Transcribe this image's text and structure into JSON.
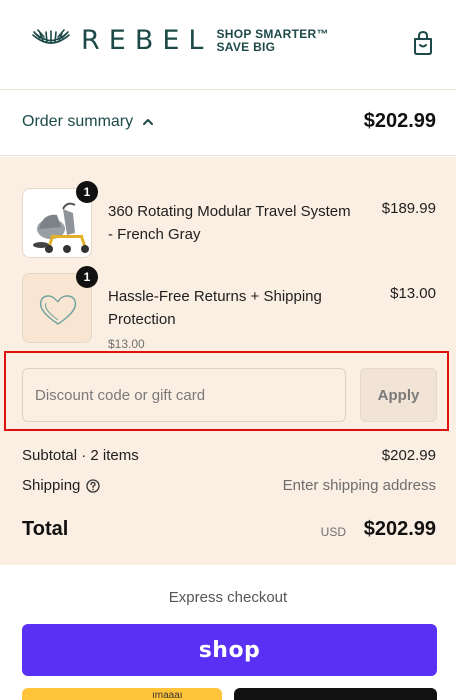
{
  "brand": {
    "name": "REBEL",
    "tagline_line1": "SHOP SMARTER™",
    "tagline_line2": "SAVE BIG",
    "color": "#1d4a48"
  },
  "summary": {
    "toggle_label": "Order summary",
    "total": "$202.99"
  },
  "items": [
    {
      "name": "360 Rotating Modular Travel System - French Gray",
      "price": "$189.99",
      "quantity": "1",
      "image": "stroller-image"
    },
    {
      "name": "Hassle-Free Returns + Shipping Protection",
      "price": "$13.00",
      "unit_price": "$13.00",
      "quantity": "1",
      "image": "heart-icon"
    }
  ],
  "discount": {
    "placeholder": "Discount code or gift card",
    "apply_label": "Apply"
  },
  "totals": {
    "subtotal_label": "Subtotal · 2 items",
    "subtotal_value": "$202.99",
    "shipping_label": "Shipping",
    "shipping_value": "Enter shipping address",
    "total_label": "Total",
    "currency": "USD",
    "total_value": "$202.99"
  },
  "express": {
    "label": "Express checkout",
    "shop_pay_label": "shop",
    "shop_pay_color": "#5a31f4",
    "paypal_color": "#ffc439",
    "paypal_partial_text": "ımaaaı"
  },
  "colors": {
    "panel_bg": "#fbeee2",
    "highlight_border": "#e01010"
  }
}
